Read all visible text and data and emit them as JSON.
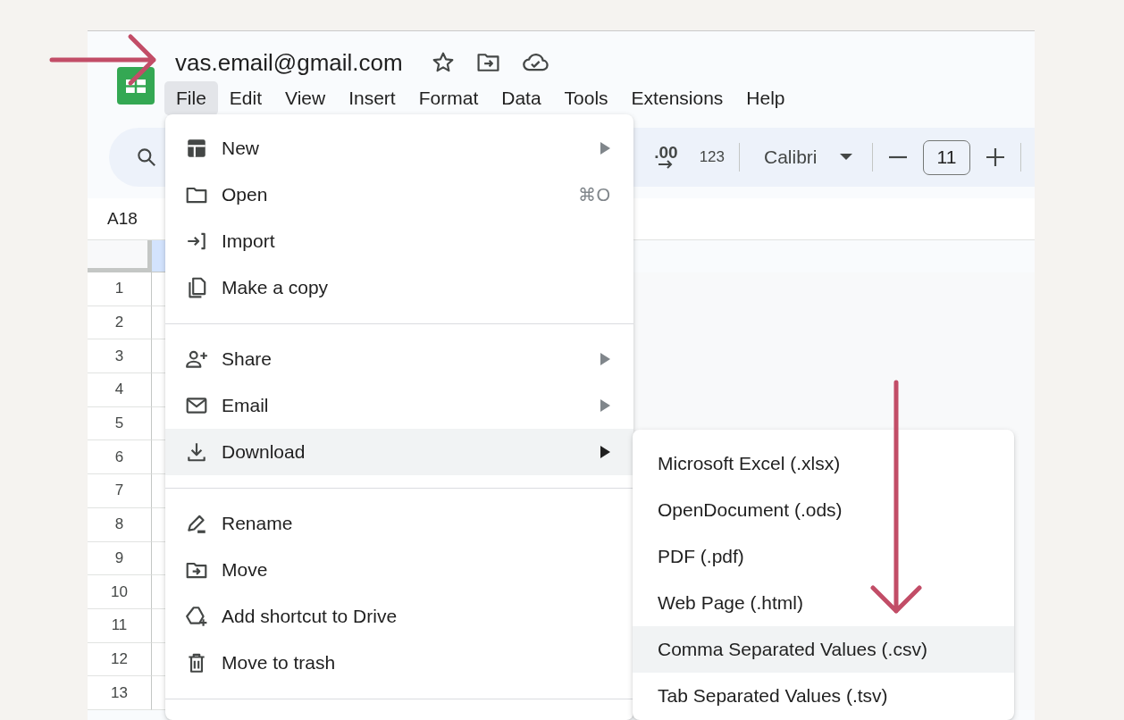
{
  "document": {
    "title": "vas.email@gmail.com"
  },
  "menu_bar": [
    {
      "label": "File",
      "selected": true
    },
    {
      "label": "Edit",
      "selected": false
    },
    {
      "label": "View",
      "selected": false
    },
    {
      "label": "Insert",
      "selected": false
    },
    {
      "label": "Format",
      "selected": false
    },
    {
      "label": "Data",
      "selected": false
    },
    {
      "label": "Tools",
      "selected": false
    },
    {
      "label": "Extensions",
      "selected": false
    },
    {
      "label": "Help",
      "selected": false
    }
  ],
  "toolbar": {
    "increase_decimals": ".00",
    "number_format": "123",
    "font": "Calibri",
    "font_size": "11"
  },
  "name_box": "A18",
  "grid": {
    "rows": [
      {
        "number": "1"
      },
      {
        "number": "2"
      },
      {
        "number": "3"
      },
      {
        "number": "4"
      },
      {
        "number": "5"
      },
      {
        "number": "6"
      },
      {
        "number": "7"
      },
      {
        "number": "8"
      },
      {
        "number": "9"
      },
      {
        "number": "10"
      },
      {
        "number": "11"
      },
      {
        "number": "12"
      },
      {
        "number": "13"
      }
    ]
  },
  "file_menu": {
    "items": [
      {
        "kind": "item",
        "label": "New",
        "has_submenu": true,
        "selected": false
      },
      {
        "kind": "item",
        "label": "Open",
        "shortcut": "⌘O",
        "has_submenu": false,
        "selected": false
      },
      {
        "kind": "item",
        "label": "Import",
        "has_submenu": false,
        "selected": false
      },
      {
        "kind": "item",
        "label": "Make a copy",
        "has_submenu": false,
        "selected": false
      },
      {
        "kind": "divider"
      },
      {
        "kind": "item",
        "label": "Share",
        "has_submenu": true,
        "selected": false
      },
      {
        "kind": "item",
        "label": "Email",
        "has_submenu": true,
        "selected": false
      },
      {
        "kind": "item",
        "label": "Download",
        "has_submenu": true,
        "selected": true
      },
      {
        "kind": "divider"
      },
      {
        "kind": "item",
        "label": "Rename",
        "has_submenu": false,
        "selected": false
      },
      {
        "kind": "item",
        "label": "Move",
        "has_submenu": false,
        "selected": false
      },
      {
        "kind": "item",
        "label": "Add shortcut to Drive",
        "has_submenu": false,
        "selected": false
      },
      {
        "kind": "item",
        "label": "Move to trash",
        "has_submenu": false,
        "selected": false
      },
      {
        "kind": "divider"
      }
    ]
  },
  "download_menu": {
    "items": [
      {
        "label": "Microsoft Excel (.xlsx)",
        "selected": false
      },
      {
        "label": "OpenDocument (.ods)",
        "selected": false
      },
      {
        "label": "PDF (.pdf)",
        "selected": false
      },
      {
        "label": "Web Page (.html)",
        "selected": false
      },
      {
        "label": "Comma Separated Values (.csv)",
        "selected": true
      },
      {
        "label": "Tab Separated Values (.tsv)",
        "selected": false
      }
    ]
  },
  "annotations": [
    {
      "kind": "right-arrow"
    },
    {
      "kind": "down-arrow"
    }
  ]
}
